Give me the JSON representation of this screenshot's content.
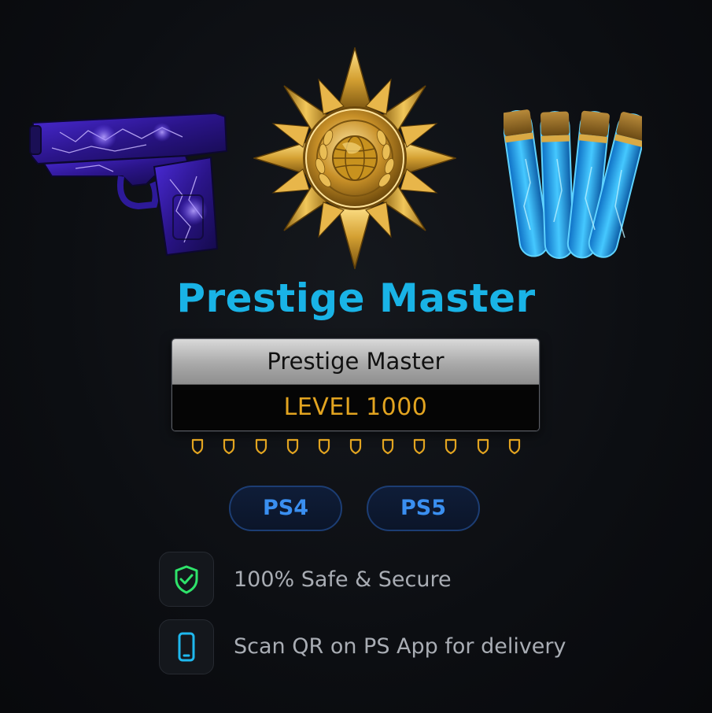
{
  "title": "Prestige Master",
  "plate": {
    "label": "Prestige Master",
    "level": "LEVEL 1000"
  },
  "rank_shields": {
    "count": 11,
    "icon": "shield-icon",
    "color": "#e2a420"
  },
  "platforms": [
    "PS4",
    "PS5"
  ],
  "features": [
    {
      "icon": "shield-check-icon",
      "text": "100% Safe & Secure",
      "color": "#2ee36a"
    },
    {
      "icon": "phone-icon",
      "text": "Scan QR on PS App for delivery",
      "color": "#1fb8ee"
    }
  ],
  "items": {
    "left": "pistol-icon",
    "center": "prestige-emblem-icon",
    "right": "vials-icon"
  },
  "colors": {
    "accent": "#19b3e6",
    "gold": "#e2a420",
    "platform": "#3a8ff0"
  }
}
